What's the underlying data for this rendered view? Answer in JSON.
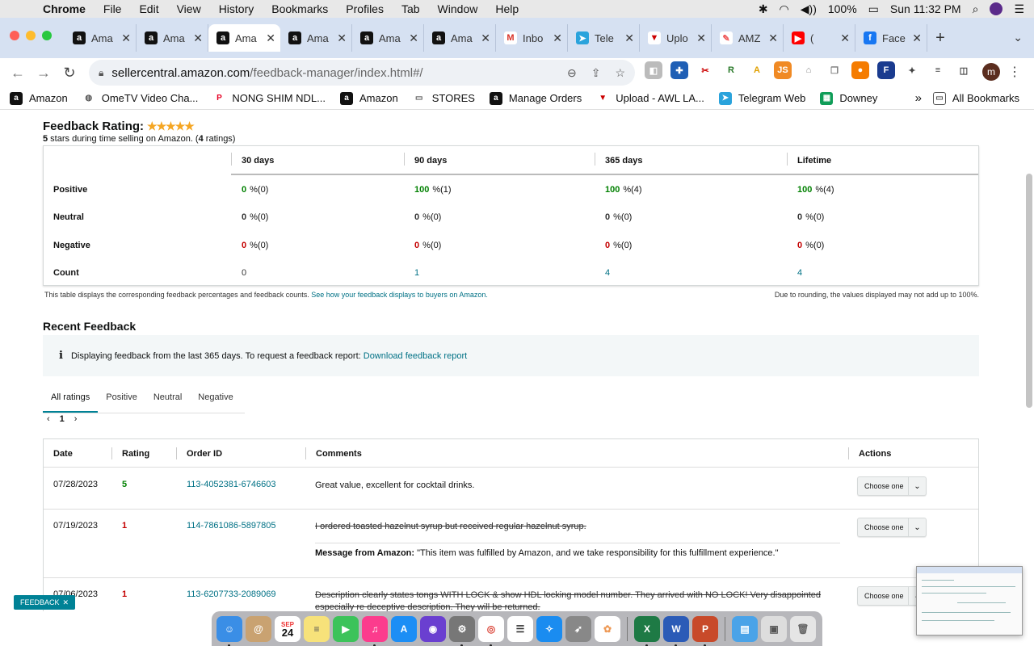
{
  "menubar": {
    "app": "Chrome",
    "items": [
      "File",
      "Edit",
      "View",
      "History",
      "Bookmarks",
      "Profiles",
      "Tab",
      "Window",
      "Help"
    ],
    "battery": "100%",
    "clock": "Sun 11:32 PM"
  },
  "tabs": [
    {
      "title": "Ama",
      "icon": "amazon-icon"
    },
    {
      "title": "Ama",
      "icon": "amazon-icon"
    },
    {
      "title": "Ama",
      "icon": "amazon-icon",
      "active": true
    },
    {
      "title": "Ama",
      "icon": "amazon-icon"
    },
    {
      "title": "Ama",
      "icon": "amazon-icon"
    },
    {
      "title": "Ama",
      "icon": "amazon-icon"
    },
    {
      "title": "Inbo",
      "icon": "gmail-icon"
    },
    {
      "title": "Tele",
      "icon": "telegram-icon"
    },
    {
      "title": "Uplo",
      "icon": "upload-icon"
    },
    {
      "title": "AMZ",
      "icon": "amz-icon"
    },
    {
      "title": "(",
      "icon": "youtube-icon"
    },
    {
      "title": "Face",
      "icon": "facebook-icon"
    }
  ],
  "address": {
    "host": "sellercentral.amazon.com",
    "path": "/feedback-manager/index.html#/"
  },
  "profile_initial": "m",
  "bookmarks": [
    {
      "label": "Amazon",
      "icon": "amazon-icon"
    },
    {
      "label": "OmeTV Video Cha...",
      "icon": "ometv-icon"
    },
    {
      "label": "NONG SHIM NDL...",
      "icon": "pinterest-icon"
    },
    {
      "label": "Amazon",
      "icon": "amazon-icon"
    },
    {
      "label": "STORES",
      "icon": "folder-icon"
    },
    {
      "label": "Manage Orders",
      "icon": "amazon-icon"
    },
    {
      "label": "Upload - AWL LA...",
      "icon": "upload-icon"
    },
    {
      "label": "Telegram Web",
      "icon": "telegram-icon"
    },
    {
      "label": "Downey",
      "icon": "sheets-icon"
    }
  ],
  "bookmarks_more": "»",
  "all_bookmarks": "All Bookmarks",
  "feedback": {
    "title": "Feedback Rating:",
    "rating_stars": 5,
    "subtitle_stars": "5",
    "subtitle_mid": " stars during time selling on Amazon. (",
    "subtitle_count": "4",
    "subtitle_end": " ratings)",
    "columns": [
      "30 days",
      "90 days",
      "365 days",
      "Lifetime"
    ],
    "rows": [
      {
        "label": "Positive",
        "values": [
          "0",
          "100",
          "100",
          "100"
        ],
        "counts": [
          "%(0)",
          "%(1)",
          "%(4)",
          "%(4)"
        ],
        "color": "g"
      },
      {
        "label": "Neutral",
        "values": [
          "0",
          "0",
          "0",
          "0"
        ],
        "counts": [
          "%(0)",
          "%(0)",
          "%(0)",
          "%(0)"
        ],
        "color": "k"
      },
      {
        "label": "Negative",
        "values": [
          "0",
          "0",
          "0",
          "0"
        ],
        "counts": [
          "%(0)",
          "%(0)",
          "%(0)",
          "%(0)"
        ],
        "color": "r"
      },
      {
        "label": "Count",
        "values": [
          "0",
          "1",
          "4",
          "4"
        ],
        "counts": [
          "",
          "",
          "",
          ""
        ],
        "color": "count"
      }
    ],
    "note_left": "This table displays the corresponding feedback percentages and feedback counts.",
    "note_link": "See how your feedback displays to buyers on Amazon.",
    "note_right": "Due to rounding, the values displayed may not add up to 100%."
  },
  "recent": {
    "title": "Recent Feedback",
    "info_text": "Displaying feedback from the last 365 days. To request a feedback report:",
    "info_link": "Download feedback report",
    "tabs": [
      "All ratings",
      "Positive",
      "Neutral",
      "Negative"
    ],
    "page": "1",
    "columns": [
      "Date",
      "Rating",
      "Order ID",
      "Comments",
      "Actions"
    ],
    "choose_label": "Choose one",
    "rows": [
      {
        "date": "07/28/2023",
        "rating": "5",
        "order": "113-4052381-6746603",
        "comment": "Great value, excellent for cocktail drinks.",
        "struck": false,
        "color": "g"
      },
      {
        "date": "07/19/2023",
        "rating": "1",
        "order": "114-7861086-5897805",
        "comment": "I ordered toasted hazelnut syrup but received regular hazelnut syrup.",
        "struck": true,
        "color": "r",
        "amazon_label": "Message from Amazon:",
        "amazon_msg": " \"This item was fulfilled by Amazon, and we take responsibility for this fulfillment experience.\""
      },
      {
        "date": "07/06/2023",
        "rating": "1",
        "order": "113-6207733-2089069",
        "comment": "Description clearly states tongs WITH LOCK & show HDL locking model number. They arrived with NO LOCK! Very disappointed especially re deceptive description. They will be returned.",
        "struck": true,
        "color": "r"
      }
    ]
  },
  "feedback_tab": "FEEDBACK",
  "calendar": {
    "month": "SEP",
    "day": "24"
  },
  "colors": {
    "accent": "#007185",
    "positive": "#008000",
    "negative": "#c40000",
    "star": "#f5a623"
  }
}
